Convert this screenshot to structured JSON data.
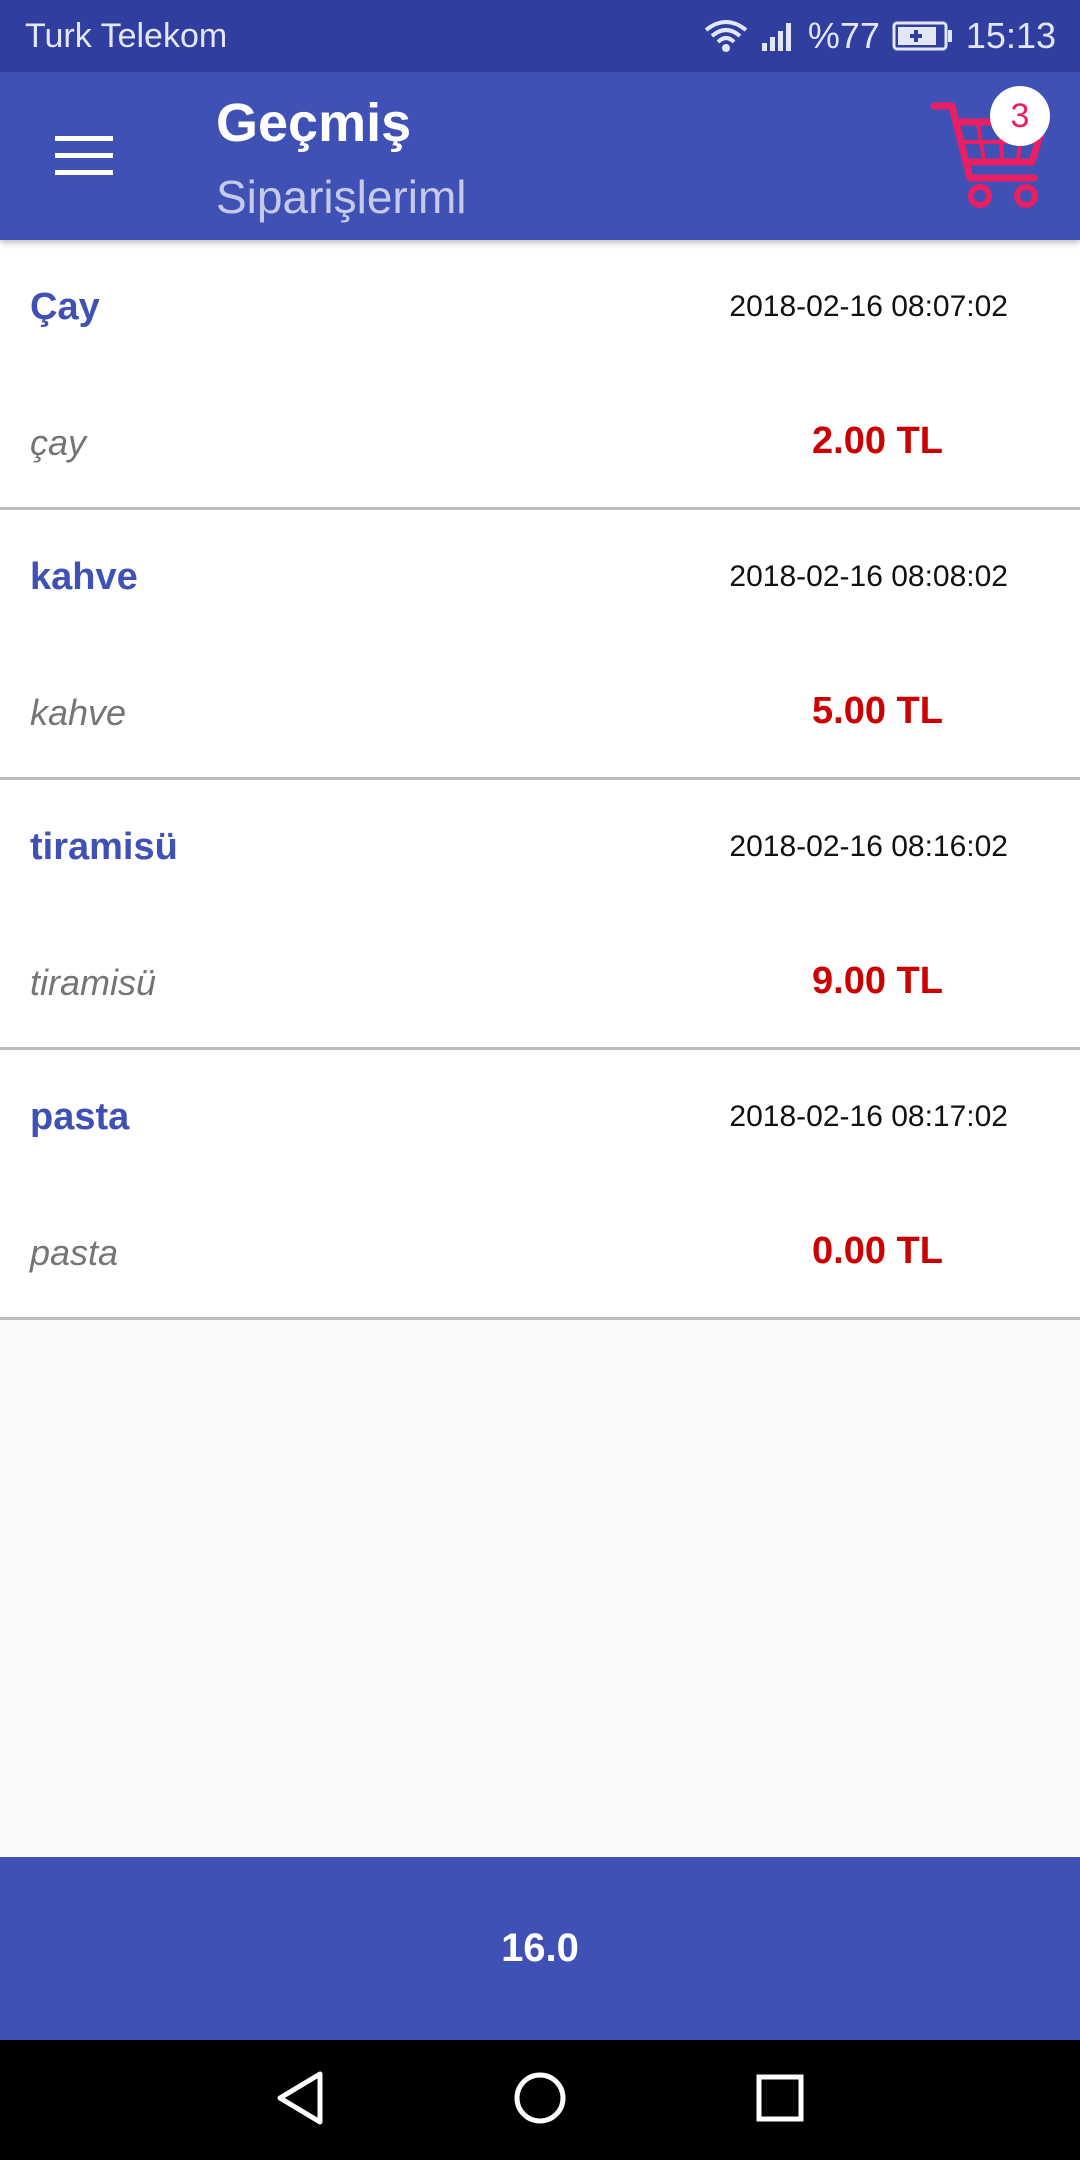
{
  "status_bar": {
    "carrier": "Turk Telekom",
    "battery": "%77",
    "time": "15:13",
    "icons": [
      "wifi-icon",
      "signal-icon",
      "battery-charging-icon"
    ]
  },
  "app_bar": {
    "title": "Geçmiş",
    "subtitle": "Siparişleriml",
    "menu_icon": "hamburger-menu-icon",
    "cart_icon": "shopping-cart-icon",
    "cart_count": "3"
  },
  "orders": [
    {
      "name": "Çay",
      "date": "2018-02-16 08:07:02",
      "description": "çay",
      "price": "2.00 TL"
    },
    {
      "name": "kahve",
      "date": "2018-02-16 08:08:02",
      "description": "kahve",
      "price": "5.00 TL"
    },
    {
      "name": "tiramisü",
      "date": "2018-02-16 08:16:02",
      "description": "tiramisü",
      "price": "9.00 TL"
    },
    {
      "name": "pasta",
      "date": "2018-02-16 08:17:02",
      "description": "pasta",
      "price": "0.00 TL"
    }
  ],
  "total": "16.0",
  "nav_bar": {
    "icons": [
      "back-icon",
      "home-icon",
      "recents-icon"
    ]
  },
  "colors": {
    "primary": "#3f51b5",
    "primary_dark": "#303f9f",
    "accent": "#e91e63",
    "price": "#cc0000",
    "name": "#3f51b5"
  }
}
